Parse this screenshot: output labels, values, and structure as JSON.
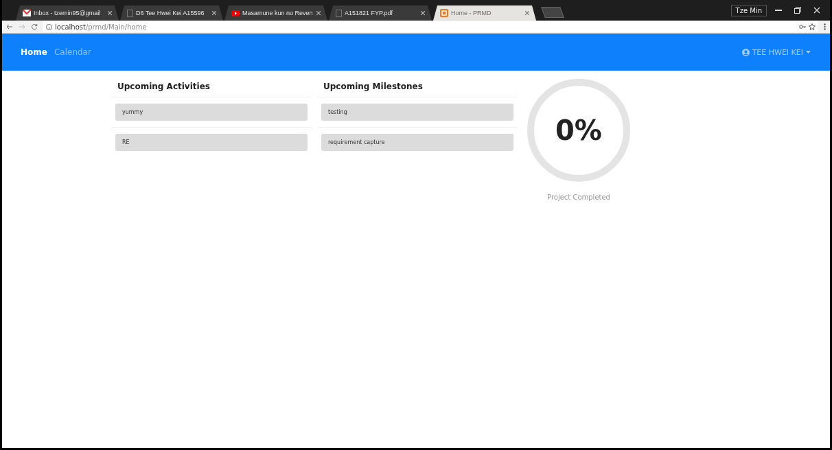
{
  "browser": {
    "tabs": [
      {
        "title": "Inbox - tzemin95@gmail",
        "kind": "mail",
        "selected": false
      },
      {
        "title": "D6 Tee Hwei Kei A15596",
        "kind": "doc",
        "selected": false
      },
      {
        "title": "Masamune kun no Reven",
        "kind": "video",
        "selected": false
      },
      {
        "title": "A151821 FYP.pdf",
        "kind": "doc",
        "selected": false
      },
      {
        "title": "Home - PRMD",
        "kind": "app",
        "selected": true
      }
    ],
    "profile": "Tze Min",
    "address_host": "localhost",
    "address_path": "/prmd/Main/home"
  },
  "navbar": {
    "links": [
      {
        "label": "Home",
        "selected": true
      },
      {
        "label": "Calendar",
        "selected": false
      }
    ],
    "user": "TEE HWEI KEI"
  },
  "columns": [
    {
      "title": "Upcoming Activities",
      "items": [
        "yummy",
        "RE"
      ]
    },
    {
      "title": "Upcoming Milestones",
      "items": [
        "testing",
        "requirement capture"
      ]
    }
  ],
  "progress": {
    "percent": "0%",
    "caption": "Project Completed"
  }
}
